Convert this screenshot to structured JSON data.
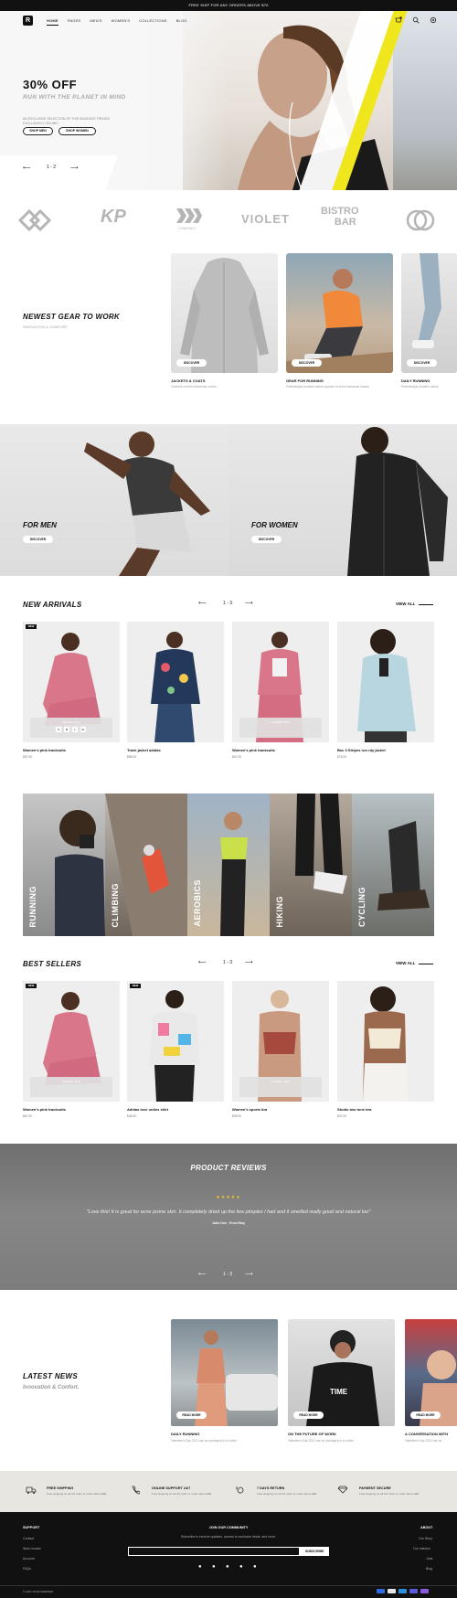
{
  "topbar": {
    "text": "FREE SHIP FOR ANY ORDERS ABOVE $70"
  },
  "nav": {
    "logo": "R",
    "links": [
      "HOME",
      "PAGES",
      "MEN'S",
      "WOMEN'S",
      "COLLECTIONS",
      "BLOG"
    ],
    "icons": [
      "cart-icon",
      "search-icon",
      "settings-icon"
    ]
  },
  "hero": {
    "title": "30% OFF",
    "subtitle": "RUN WITH THE PLANET IN MIND",
    "description": "AN EXCLUSIVE SELECTION OF THIS SEASON'S TRENDS. EXCLUSIVELY ONLINE!",
    "btn_men": "SHOP MEN",
    "btn_women": "SHOP WOMEN",
    "pager": "1 - 2"
  },
  "brands": [
    "KP",
    "COMPANY",
    "VIOLET",
    "BISTRO",
    "BAR"
  ],
  "gear": {
    "title": "NEWEST GEAR TO WORK",
    "subtitle": "INNOVATION & COMFORT",
    "items": [
      {
        "discover": "DISCOVER",
        "title": "JACKETS & COATS",
        "text": "Vivamus ut enim maecenas a enim."
      },
      {
        "discover": "DISCOVER",
        "title": "GEAR FOR RUNNING",
        "text": "Pellentesque proident rutrum posuere ut enim maecenas massa."
      },
      {
        "discover": "DISCOVER",
        "title": "DAILY RUNNING",
        "text": "Pellentesque proident rutrum."
      }
    ]
  },
  "promos": [
    {
      "title": "FOR MEN",
      "btn": "DISCOVER"
    },
    {
      "title": "FOR WOMEN",
      "btn": "DISCOVER"
    }
  ],
  "new_arrivals": {
    "title": "NEW ARRIVALS",
    "pager": "1 - 3",
    "view_all": "VIEW ALL",
    "sizes_label": "Available Sizes",
    "sizes": [
      "S",
      "M",
      "L",
      "XL"
    ],
    "badge": "NEW",
    "products": [
      {
        "name": "Women's pink tracksuits",
        "price": "$67.00"
      },
      {
        "name": "Track jacket adidas",
        "price": "$56.00"
      },
      {
        "name": "Women's pink tracksuits",
        "price": "$67.00"
      },
      {
        "name": "Bsc 3 Stripes run rdy jacket",
        "price": "$75.00"
      }
    ]
  },
  "categories": [
    "RUNNING",
    "CLIMBING",
    "AEROBICS",
    "HIKING",
    "CYCLING"
  ],
  "best_sellers": {
    "title": "BEST SELLERS",
    "pager": "1 - 3",
    "view_all": "VIEW ALL",
    "badge": "NEW",
    "sizes_label": "Available Sizes",
    "sizes": [
      "S",
      "M",
      "L",
      "XL"
    ],
    "products": [
      {
        "name": "Women's pink tracksuits",
        "price": "$67.00"
      },
      {
        "name": "Adidas love unites shirt",
        "price": "$45.00"
      },
      {
        "name": "Women's sports bra",
        "price": "$39.00"
      },
      {
        "name": "Studio two tone bra",
        "price": "$37.00"
      }
    ]
  },
  "reviews": {
    "title": "PRODUCT REVIEWS",
    "stars": "★★★★★",
    "quote": "\"Love this! It is great for acne prone skin. It completely dried up the few pimples I had and it smelled really good and natural too\"",
    "author": "John Doe - From Etsy",
    "pager": "1 - 3"
  },
  "news": {
    "title": "LATEST NEWS",
    "subtitle": "Innovation & Confort.",
    "items": [
      {
        "btn": "READ MORE",
        "title": "DAILY RUNNING",
        "text": "Valentine's Day 2021 has no shortage but to unlike."
      },
      {
        "btn": "READ MORE",
        "title": "ON THE FUTURE OF WORK",
        "text": "Valentine's Day 2021 has no shortage but to unlike."
      },
      {
        "btn": "READ MORE",
        "title": "A CONVERSATION WITH",
        "text": "Valentine's Day 2021 has no"
      }
    ]
  },
  "features": [
    {
      "icon": "truck-icon",
      "title": "FREE SHIPPING",
      "text": "Free shipping on all US order or order above $99"
    },
    {
      "icon": "phone-icon",
      "title": "ONLINE SUPPORT 24/7",
      "text": "Free shipping on all US order or order above $99"
    },
    {
      "icon": "return-icon",
      "title": "7 DAYS RETURN",
      "text": "Free shipping on all US order or order above $99"
    },
    {
      "icon": "diamond-icon",
      "title": "PAYMENT SECURE",
      "text": "Free shipping on all US order or order above $99"
    }
  ],
  "footer": {
    "support_title": "SUPPORT",
    "support_links": [
      "Contact",
      "Store locator",
      "Account",
      "FAQs"
    ],
    "join_title": "JOIN OUR COMMUNITY",
    "join_text": "Subscribe to receive updates, access to exclusive deals, and more.",
    "subscribe": "SUBSCRIBE",
    "about_title": "ABOUT",
    "about_links": [
      "Our Story",
      "Our mission",
      "Jobs",
      "Blog"
    ],
    "copyright": "© 2021 WOW PREMIER",
    "colors": {
      "bg": "#111111",
      "accent": "#f0e61e"
    }
  }
}
